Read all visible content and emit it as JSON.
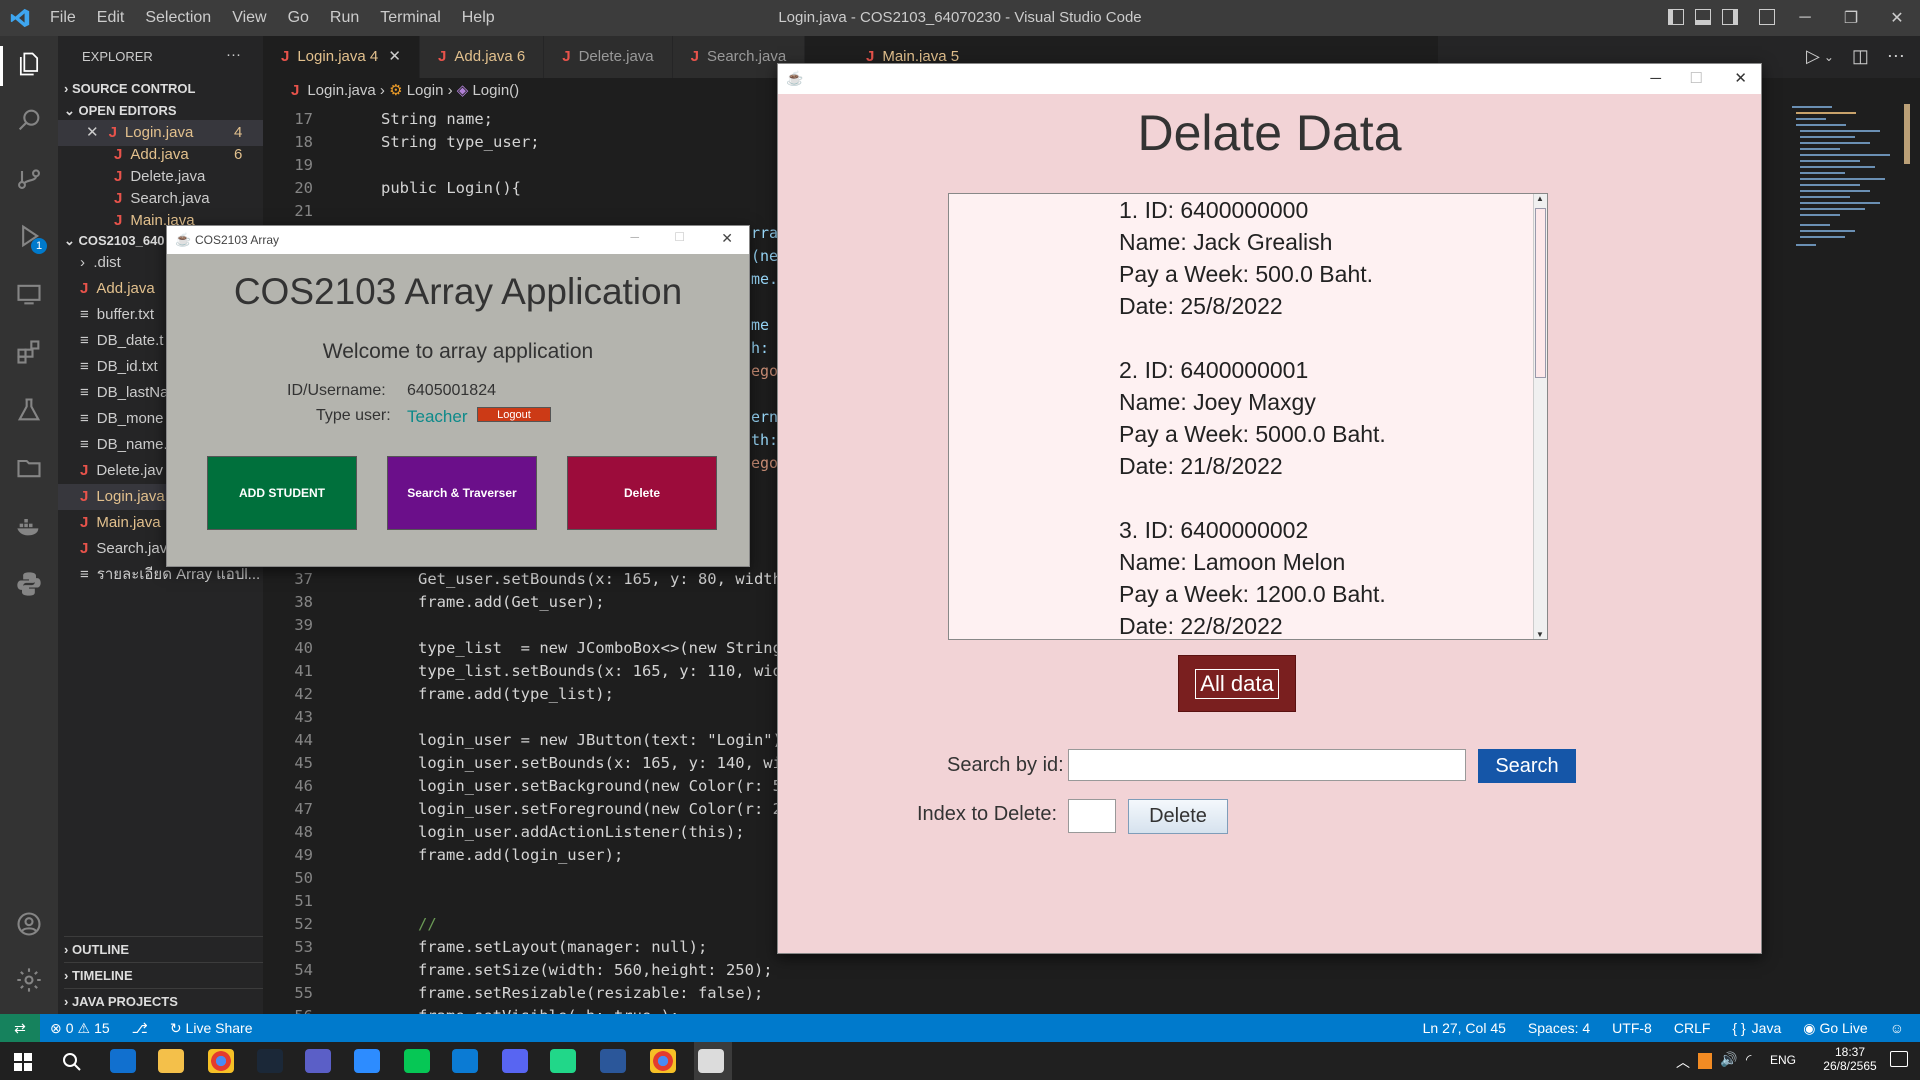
{
  "vscode": {
    "menu": [
      "File",
      "Edit",
      "Selection",
      "View",
      "Go",
      "Run",
      "Terminal",
      "Help"
    ],
    "window_title": "Login.java - COS2103_64070230 - Visual Studio Code",
    "explorer": {
      "title": "EXPLORER",
      "more": "···",
      "source_control": "SOURCE CONTROL",
      "open_editors": "OPEN EDITORS",
      "open_items": [
        {
          "name": "Login.java",
          "badge": "4",
          "active": true
        },
        {
          "name": "Add.java",
          "badge": "6"
        },
        {
          "name": "Delete.java",
          "badge": ""
        },
        {
          "name": "Search.java",
          "badge": ""
        },
        {
          "name": "Main.java",
          "badge": ""
        }
      ],
      "project": "COS2103_640",
      "files": [
        {
          "name": ".dist",
          "kind": "folder"
        },
        {
          "name": "Add.java",
          "kind": "java",
          "color": "#e2c08d"
        },
        {
          "name": "buffer.txt",
          "kind": "txt"
        },
        {
          "name": "DB_date.t",
          "kind": "txt"
        },
        {
          "name": "DB_id.txt",
          "kind": "txt"
        },
        {
          "name": "DB_lastNa",
          "kind": "txt"
        },
        {
          "name": "DB_mone",
          "kind": "txt"
        },
        {
          "name": "DB_name.",
          "kind": "txt"
        },
        {
          "name": "Delete.jav",
          "kind": "java"
        },
        {
          "name": "Login.java",
          "kind": "java",
          "color": "#e2c08d",
          "selected": true
        },
        {
          "name": "Main.java",
          "kind": "java",
          "color": "#e2c08d"
        },
        {
          "name": "Search.java",
          "kind": "java"
        },
        {
          "name": "รายละเอียด Array แอปl...",
          "kind": "txt"
        }
      ],
      "outline": "OUTLINE",
      "timeline": "TIMELINE",
      "java_projects": "JAVA PROJECTS"
    },
    "tabs": [
      {
        "name": "Login.java",
        "badge": "4",
        "active": true
      },
      {
        "name": "Add.java",
        "badge": "6"
      },
      {
        "name": "Delete.java",
        "badge": ""
      },
      {
        "name": "Search.java",
        "badge": ""
      },
      {
        "name": "Main.java",
        "badge": "5"
      }
    ],
    "breadcrumb": [
      "Login.java",
      "Login",
      "Login()"
    ],
    "status": {
      "errors": "0",
      "warnings": "15",
      "live_share": "Live Share",
      "position": "Ln 27, Col 45",
      "spaces": "Spaces: 4",
      "encoding": "UTF-8",
      "eol": "CRLF",
      "language": "Java",
      "go_live": "Go Live"
    }
  },
  "code_lines": [
    {
      "n": "17",
      "t": "String name;"
    },
    {
      "n": "18",
      "t": "String type_user;"
    },
    {
      "n": "19",
      "t": ""
    },
    {
      "n": "20",
      "t": "public Login(){"
    },
    {
      "n": "21",
      "t": ""
    },
    {
      "n": "37",
      "t": "Get_user.setBounds(x: 165, y: 80, width:"
    },
    {
      "n": "38",
      "t": "frame.add(Get_user);"
    },
    {
      "n": "39",
      "t": ""
    },
    {
      "n": "40",
      "t": "type_list  = new JComboBox<>(new String"
    },
    {
      "n": "41",
      "t": "type_list.setBounds(x: 165, y: 110, widt"
    },
    {
      "n": "42",
      "t": "frame.add(type_list);"
    },
    {
      "n": "43",
      "t": ""
    },
    {
      "n": "44",
      "t": "login_user = new JButton(text: \"Login\")"
    },
    {
      "n": "45",
      "t": "login_user.setBounds(x: 165, y: 140, wid"
    },
    {
      "n": "46",
      "t": "login_user.setBackground(new Color(r: 5"
    },
    {
      "n": "47",
      "t": "login_user.setForeground(new Color(r: 2"
    },
    {
      "n": "48",
      "t": "login_user.addActionListener(this);"
    },
    {
      "n": "49",
      "t": "frame.add(login_user);"
    },
    {
      "n": "50",
      "t": ""
    },
    {
      "n": "51",
      "t": ""
    },
    {
      "n": "52",
      "t": "//"
    },
    {
      "n": "53",
      "t": "frame.setLayout(manager: null);"
    },
    {
      "n": "54",
      "t": "frame.setSize(width: 560,height: 250);"
    },
    {
      "n": "55",
      "t": "frame.setResizable(resizable: false);"
    },
    {
      "n": "56",
      "t": "frame.setVisible( b: true );"
    }
  ],
  "code_peek": [
    "rray",
    "(ne",
    "me.",
    "me",
    "h:",
    "ego",
    "erna",
    "th:",
    "ego"
  ],
  "array_app": {
    "window_title": "COS2103 Array",
    "heading": "COS2103 Array Application",
    "welcome": "Welcome to array application",
    "id_label": "ID/Username:",
    "id_value": "6405001824",
    "type_label": "Type user:",
    "type_value": "Teacher",
    "logout": "Logout",
    "buttons": [
      {
        "label": "ADD STUDENT",
        "color": "#00703c"
      },
      {
        "label": "Search & Traverser",
        "color": "#6b0f8a"
      },
      {
        "label": "Delete",
        "color": "#9c0c3b"
      }
    ]
  },
  "delete_app": {
    "heading": "Delate Data",
    "records": [
      {
        "lines": [
          "1. ID: 6400000000",
          " Name: Jack Grealish",
          " Pay a Week: 500.0 Baht.",
          " Date: 25/8/2022"
        ]
      },
      {
        "lines": [
          "2. ID: 6400000001",
          " Name: Joey Maxgy",
          " Pay a Week: 5000.0 Baht.",
          " Date: 21/8/2022"
        ]
      },
      {
        "lines": [
          "3. ID: 6400000002",
          " Name: Lamoon Melon",
          " Pay a Week: 1200.0 Baht.",
          " Date: 22/8/2022"
        ]
      }
    ],
    "all_data": "All data",
    "search_label": "Search by id:",
    "search_value": "",
    "search_button": "Search",
    "index_label": "Index to Delete:",
    "index_value": "",
    "delete_button": "Delete"
  },
  "taskbar": {
    "lang": "ENG",
    "time": "18:37",
    "date": "26/8/2565"
  },
  "colors": {
    "accent": "#007acc",
    "java_bg": "#f2d3d6",
    "all_data_btn": "#7a1f1f",
    "search_btn": "#1556a8"
  }
}
